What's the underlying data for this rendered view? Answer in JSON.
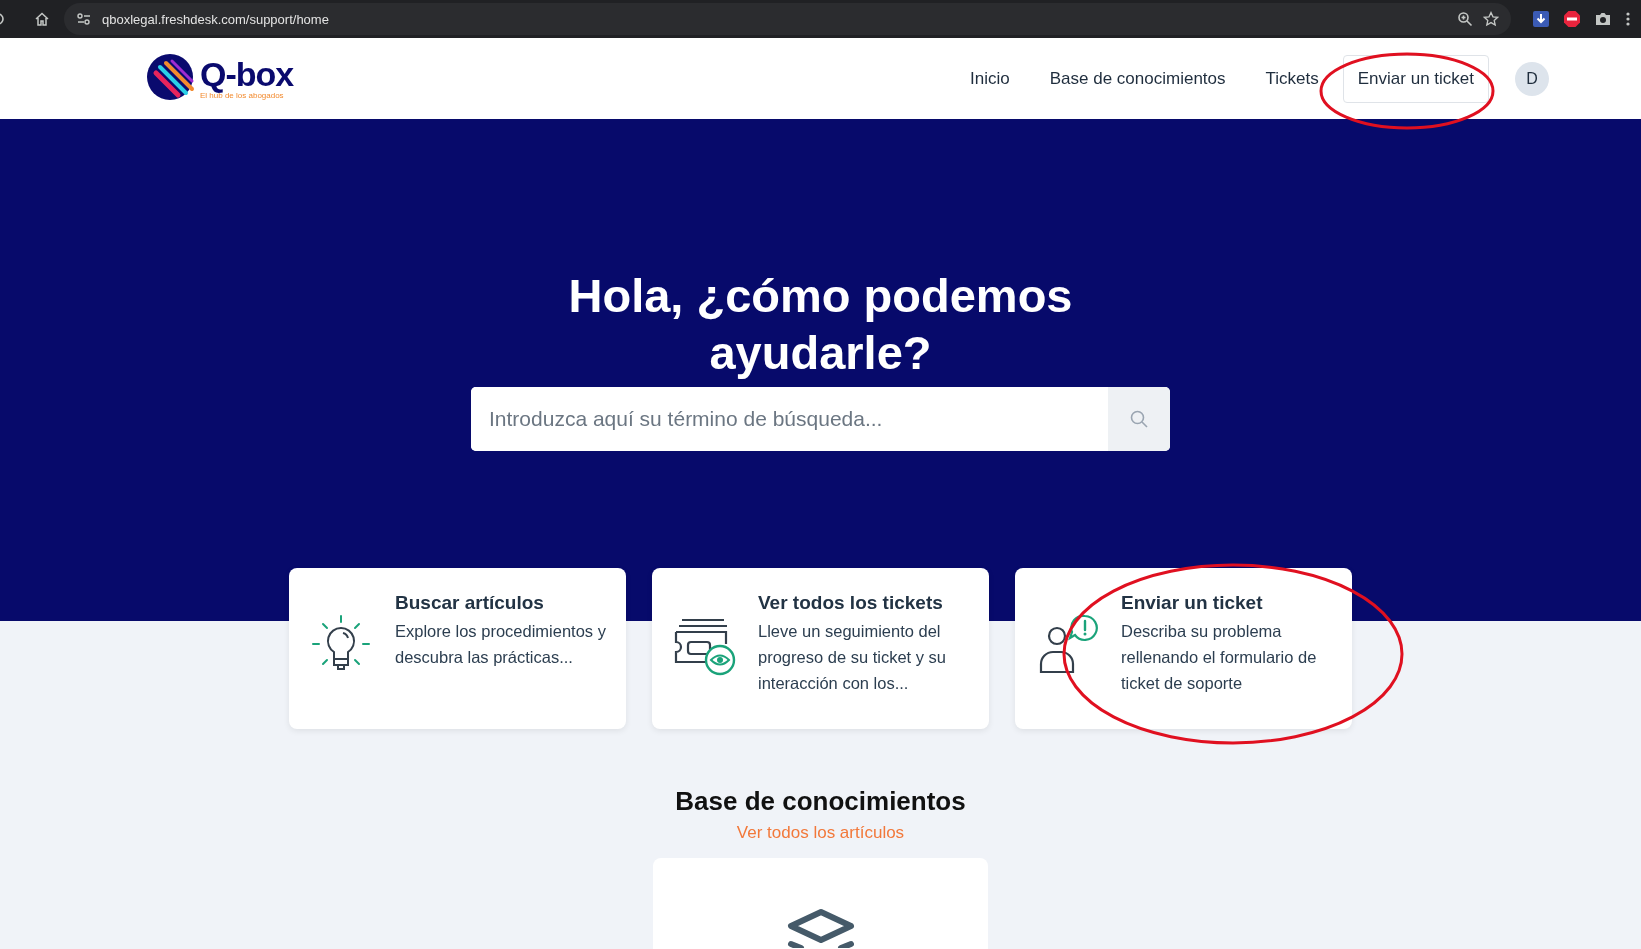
{
  "browser": {
    "url": "qboxlegal.freshdesk.com/support/home"
  },
  "header": {
    "logo": {
      "name": "Q-box",
      "tagline": "El hub de los abogados"
    },
    "nav": [
      {
        "label": "Inicio",
        "kind": "link"
      },
      {
        "label": "Base de conocimientos",
        "kind": "link"
      },
      {
        "label": "Tickets",
        "kind": "link"
      },
      {
        "label": "Enviar un ticket",
        "kind": "button"
      }
    ],
    "avatar": "D"
  },
  "hero": {
    "title": "Hola, ¿cómo podemos ayudarle?",
    "search": {
      "placeholder": "Introduzca aquí su término de búsqueda..."
    }
  },
  "cards": [
    {
      "kind": "articles",
      "title": "Buscar artículos",
      "text": "Explore los procedimientos y descubra las prácticas..."
    },
    {
      "kind": "tickets",
      "title": "Ver todos los tickets",
      "text": "Lleve un seguimiento del progreso de su ticket y su interacción con los..."
    },
    {
      "kind": "submit",
      "title": "Enviar un ticket",
      "text": "Describa su problema rellenando el formulario de ticket de soporte"
    }
  ],
  "knowledge_base": {
    "title": "Base de conocimientos",
    "link": "Ver todos los artículos"
  }
}
